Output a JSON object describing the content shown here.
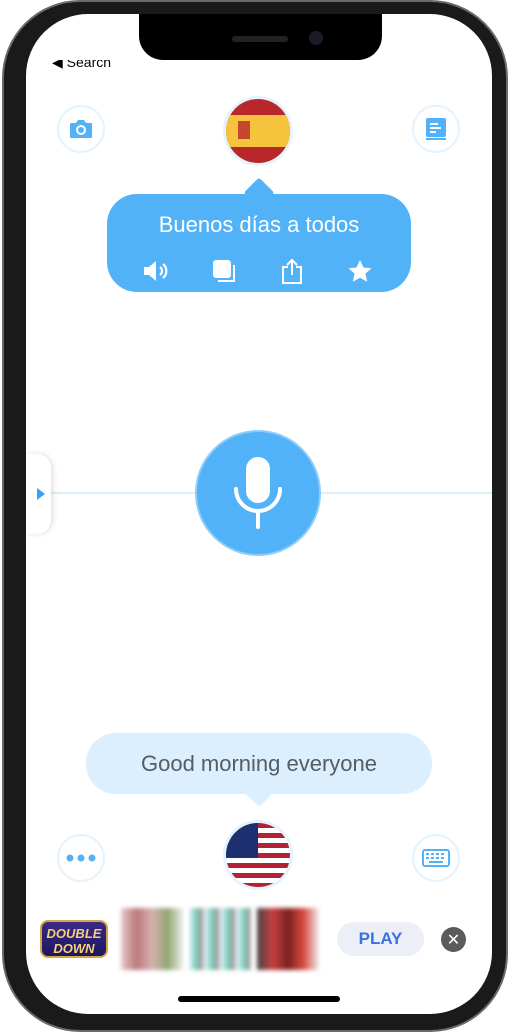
{
  "status": {
    "back_label": "◀ Search"
  },
  "top": {
    "left_button": "camera-icon",
    "right_button": "book-icon",
    "language_flag": "spain-flag"
  },
  "translation": {
    "text": "Buenos días a todos",
    "actions": [
      "speaker-icon",
      "copy-icon",
      "share-icon",
      "star-icon"
    ]
  },
  "source": {
    "text": "Good morning everyone"
  },
  "bottom": {
    "left_button": "more-icon",
    "right_button": "keyboard-icon",
    "language_flag": "us-flag"
  },
  "ad": {
    "logo": "DOUBLE DOWN",
    "play_label": "PLAY",
    "close": "✕"
  },
  "colors": {
    "accent": "#52b2f8",
    "bubble_light": "#dcefff",
    "play_text": "#3a6fe6"
  }
}
